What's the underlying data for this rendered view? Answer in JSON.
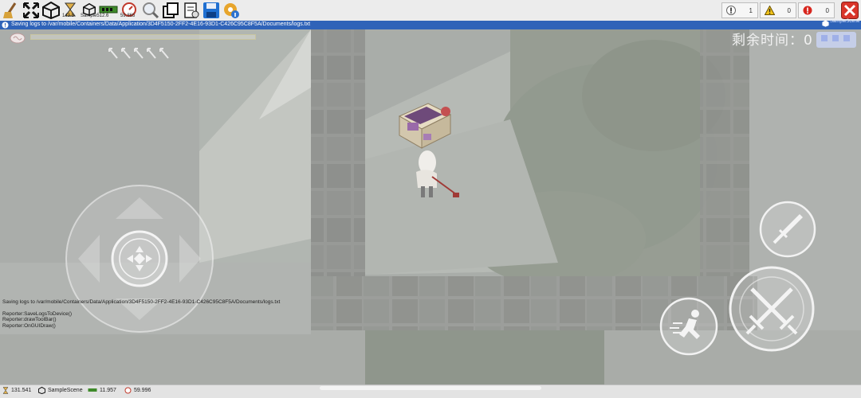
{
  "toolbar": {
    "fps_1": "143.5",
    "sample_size": "Sample512.6",
    "fps_2": "59.865",
    "log_count": "1",
    "warning_count": "0",
    "error_count": "0"
  },
  "status_bar": {
    "message": "Saving logs to /var/mobile/Containers/Data/Application/3D4F5150-2FF2-4E16-93D1-C426C95C8F5A/Documents/logs.txt",
    "scene_label": "SampleScene"
  },
  "hud": {
    "timer_text": "剩余时间：0"
  },
  "console": {
    "lines": [
      "Saving logs to /var/mobile/Containers/Data/Application/3D4F5150-2FF2-4E16-93D1-C426C95C8F5A/Documents/logs.txt",
      "",
      "Reporter:SaveLogsToDevice()",
      "Reporter:drawToolBar()",
      "Reporter:OnGUIDraw()"
    ]
  },
  "bottom_bar": {
    "memory": "131.541",
    "scene": "SampleScene",
    "gc_memory": "11.957",
    "fps": "59.996"
  },
  "colors": {
    "status_blue": "#2f63b8",
    "toolbar_bg": "#ececec",
    "close_red": "#d9352a"
  }
}
